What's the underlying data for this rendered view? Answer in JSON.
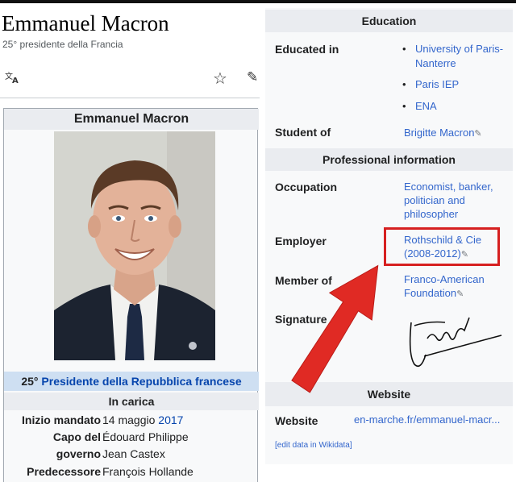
{
  "left": {
    "title": "Emmanuel Macron",
    "subtitle": "25° presidente della Francia",
    "infobox": {
      "title": "Emmanuel Macron",
      "role_prefix": "25°",
      "role_link": "Presidente della Repubblica francese",
      "in_carica": "In carica",
      "rows": [
        {
          "label": "Inizio mandato",
          "value_text": "14 maggio",
          "value_link": "2017"
        },
        {
          "label": "Capo del",
          "value_link": "Édouard Philippe"
        },
        {
          "label": "governo",
          "value_link": "Jean Castex"
        },
        {
          "label": "Predecessore",
          "value_link": "François Hollande"
        }
      ]
    }
  },
  "right": {
    "education_head": "Education",
    "educated_in_label": "Educated in",
    "educated_in": [
      "University of Paris-",
      "Nanterre",
      "Paris IEP",
      "ENA"
    ],
    "student_of_label": "Student of",
    "student_of_value": "Brigitte Macron",
    "professional_head": "Professional information",
    "occupation_label": "Occupation",
    "occupation_lines": [
      "Economist, banker,",
      "politician and",
      "philosopher"
    ],
    "employer_label": "Employer",
    "employer_lines": [
      "Rothschild & Cie",
      "(2008-2012)"
    ],
    "member_label": "Member of",
    "member_lines": [
      "Franco-American",
      "Foundation"
    ],
    "signature_label": "Signature",
    "website_head": "Website",
    "website_label": "Website",
    "website_value": "en-marche.fr/emmanuel-macr...",
    "edit_data": "[edit data in Wikidata]"
  },
  "colors": {
    "highlight": "#d62020",
    "link": "#3366cc",
    "infobox_role_bg": "#cedff2"
  },
  "icons": [
    "translate-icon",
    "star-icon",
    "pencil-icon",
    "arrow-icon"
  ]
}
